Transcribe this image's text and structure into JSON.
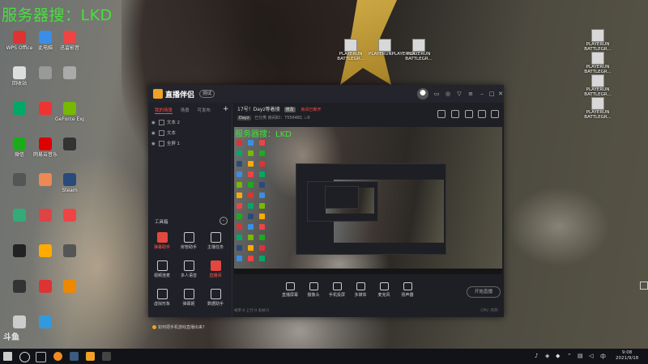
{
  "overlay_title": "服务器搜：LKD",
  "desktop_icons": [
    {
      "label": "WPS Office",
      "color": "#d33"
    },
    {
      "label": "此电脑",
      "color": "#3a8ee6"
    },
    {
      "label": "迅雷影音",
      "color": "#e44"
    },
    {
      "label": "回收站",
      "color": "#ddd"
    },
    {
      "label": "",
      "color": "#999"
    },
    {
      "label": "",
      "color": "#aaa"
    },
    {
      "label": "",
      "color": "#0a6"
    },
    {
      "label": "",
      "color": "#e33"
    },
    {
      "label": "GeForce Experience",
      "color": "#76b900"
    },
    {
      "label": "微信",
      "color": "#1aad19"
    },
    {
      "label": "网易云音乐",
      "color": "#d00"
    },
    {
      "label": "",
      "color": "#333"
    },
    {
      "label": "",
      "color": "#555"
    },
    {
      "label": "",
      "color": "#e85"
    },
    {
      "label": "Steam",
      "color": "#2a4a7a"
    },
    {
      "label": "",
      "color": "#3a7"
    },
    {
      "label": "",
      "color": "#d44"
    },
    {
      "label": "",
      "color": "#e44"
    },
    {
      "label": "",
      "color": "#222"
    },
    {
      "label": "",
      "color": "#fa0"
    },
    {
      "label": "",
      "color": "#555"
    },
    {
      "label": "",
      "color": "#333"
    },
    {
      "label": "",
      "color": "#d33"
    },
    {
      "label": "",
      "color": "#e80"
    },
    {
      "label": "",
      "color": "#ccc"
    },
    {
      "label": "",
      "color": "#39d"
    }
  ],
  "top_window_labels": [
    "PLAYERUN BATTLEGR...",
    "PLAYERUNPLAYERUN...",
    "PLAYERUN BATTLEGR..."
  ],
  "right_icons": [
    "PLAYERUN BATTLEGR...",
    "PLAYERUN BATTLEGR...",
    "PLAYERUN BATTLEGR...",
    "PLAYERUN BATTLEGR..."
  ],
  "app": {
    "brand": "直播伴侣",
    "version": "测试",
    "sidebar_tabs": [
      "我的场景",
      "场景",
      "可发布"
    ],
    "sources": [
      "文本 2",
      "文本",
      "全屏 1"
    ],
    "tools_title": "工具箱",
    "tools": [
      {
        "label": "弹幕助手",
        "red": true
      },
      {
        "label": "房管助手",
        "red": false
      },
      {
        "label": "主播任务",
        "red": false
      },
      {
        "label": "视频连麦",
        "red": false
      },
      {
        "label": "多人语音",
        "red": false
      },
      {
        "label": "直播间",
        "red": true
      },
      {
        "label": "虚拟形象",
        "red": false
      },
      {
        "label": "弹幕姬",
        "red": false
      },
      {
        "label": "数据助手",
        "red": false
      }
    ],
    "tip": "如何把手机游戏直播出来？",
    "stream_title": "17号！Dayz等着搜",
    "category_badge": "修改",
    "status_badge": "房间已断开",
    "count": "0",
    "sub_pill": "Dayz",
    "sub_text1": "已分类",
    "sub_text2": "房间ID：7556481",
    "bottom_buttons": [
      "直播屏幕",
      "摄像头",
      "手机投屏",
      "多媒体",
      "麦克风",
      "扬声器"
    ],
    "start_label": "开始直播",
    "status_left": "帧率:0 上行:0 丢帧:0",
    "status_right": "CPU:  内存:"
  },
  "taskbar": {
    "time": "9:08",
    "date": "2021/9/18"
  },
  "watermark": "斗鱼"
}
